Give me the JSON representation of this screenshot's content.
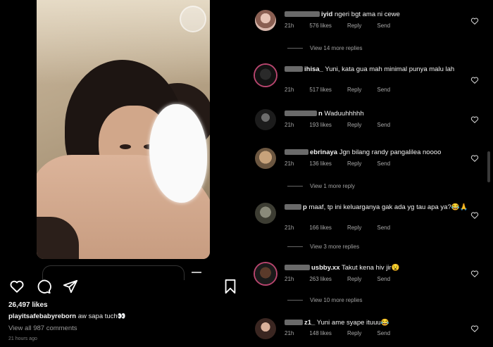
{
  "post": {
    "likes": "26,497 likes",
    "caption_user": "playitsafebabyreborn",
    "caption_text": "aw sapa tuch👀",
    "view_all": "View all 987 comments",
    "time": "21 hours ago"
  },
  "icons": {
    "like": "heart-icon",
    "comment": "comment-icon",
    "share": "paper-plane-icon",
    "save": "bookmark-icon"
  },
  "comments": [
    {
      "username": "iyid",
      "text": "ngeri bgt ama ni cewe",
      "time": "21h",
      "likes": "576 likes",
      "reply": "Reply",
      "send": "Send"
    },
    {
      "username": "ihisa_",
      "text": "Yuni, kata gua mah minimal punya malu lah",
      "time": "21h",
      "likes": "517 likes",
      "reply": "Reply",
      "send": "Send"
    },
    {
      "username": "n",
      "text": "Waduuhhhhh",
      "time": "21h",
      "likes": "193 likes",
      "reply": "Reply",
      "send": "Send"
    },
    {
      "username": "ebrinaya",
      "text": "Jgn bilang randy pangalilea noooo",
      "time": "21h",
      "likes": "136 likes",
      "reply": "Reply",
      "send": "Send"
    },
    {
      "username": "p",
      "text": "maaf, tp ini keluarganya gak ada yg tau apa ya?😂🙏",
      "time": "21h",
      "likes": "166 likes",
      "reply": "Reply",
      "send": "Send"
    },
    {
      "username": "usbby.xx",
      "text": "Takut kena hiv jir😧",
      "time": "21h",
      "likes": "263 likes",
      "reply": "Reply",
      "send": "Send"
    },
    {
      "username": "z1_",
      "text": "Yuni ame syape ituuu😂",
      "time": "21h",
      "likes": "148 likes",
      "reply": "Reply",
      "send": "Send"
    }
  ],
  "more_replies": [
    "View 14 more replies",
    "View 1 more reply",
    "View 3 more replies",
    "View 10 more replies"
  ]
}
